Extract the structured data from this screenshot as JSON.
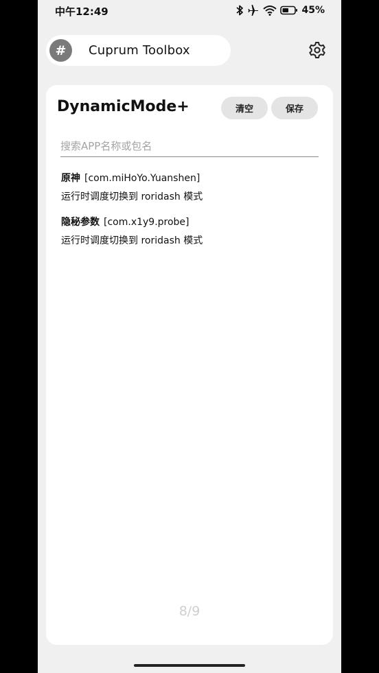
{
  "status_bar": {
    "time": "中午12:49",
    "battery_text": "45%",
    "icons": [
      "bluetooth-icon",
      "airplane-icon",
      "wifi-icon",
      "battery-icon"
    ]
  },
  "header": {
    "app_icon": "#",
    "app_title": "Cuprum Toolbox",
    "settings_icon": "gear-icon"
  },
  "card": {
    "title": "DynamicMode+",
    "clear_label": "清空",
    "save_label": "保存",
    "search_placeholder": "搜索APP名称或包名",
    "search_value": "",
    "items": [
      {
        "name": "原神",
        "package": "[com.miHoYo.Yuanshen]",
        "description": "运行时调度切换到 roridash 模式"
      },
      {
        "name": "隐秘参数",
        "package": "[com.x1y9.probe]",
        "description": "运行时调度切换到 roridash 模式"
      }
    ],
    "pager": "8/9"
  },
  "colors": {
    "background": "#f0f0f0",
    "card": "#ffffff",
    "button": "#e4e4e4",
    "app_icon_bg": "#7a7a7a",
    "pager": "#cfcfcf"
  }
}
